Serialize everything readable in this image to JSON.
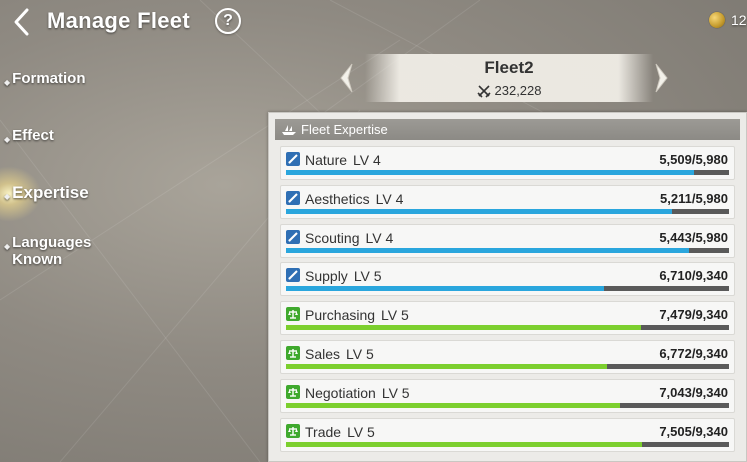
{
  "header": {
    "title": "Manage Fleet",
    "help_label": "?",
    "currency_value": "12"
  },
  "side_menu": {
    "items": [
      {
        "label": "Formation",
        "active": false
      },
      {
        "label": "Effect",
        "active": false
      },
      {
        "label": "Expertise",
        "active": true
      },
      {
        "label": "Languages Known",
        "active": false
      }
    ]
  },
  "fleet": {
    "name": "Fleet2",
    "power": "232,228"
  },
  "panel": {
    "title": "Fleet Expertise",
    "rows": [
      {
        "name": "Nature",
        "level": "LV 4",
        "value": "5,509/5,980",
        "progress": 0.921,
        "icon": "quill-icon",
        "color": "#2aa6dd"
      },
      {
        "name": "Aesthetics",
        "level": "LV 4",
        "value": "5,211/5,980",
        "progress": 0.871,
        "icon": "quill-icon",
        "color": "#2aa6dd"
      },
      {
        "name": "Scouting",
        "level": "LV 4",
        "value": "5,443/5,980",
        "progress": 0.91,
        "icon": "quill-icon",
        "color": "#2aa6dd"
      },
      {
        "name": "Supply",
        "level": "LV 5",
        "value": "6,710/9,340",
        "progress": 0.718,
        "icon": "quill-icon",
        "color": "#2aa6dd"
      },
      {
        "name": "Purchasing",
        "level": "LV 5",
        "value": "7,479/9,340",
        "progress": 0.801,
        "icon": "scales-icon",
        "color": "#7ccf2e"
      },
      {
        "name": "Sales",
        "level": "LV 5",
        "value": "6,772/9,340",
        "progress": 0.725,
        "icon": "scales-icon",
        "color": "#7ccf2e"
      },
      {
        "name": "Negotiation",
        "level": "LV 5",
        "value": "7,043/9,340",
        "progress": 0.754,
        "icon": "scales-icon",
        "color": "#7ccf2e"
      },
      {
        "name": "Trade",
        "level": "LV 5",
        "value": "7,505/9,340",
        "progress": 0.804,
        "icon": "scales-icon",
        "color": "#7ccf2e"
      }
    ]
  }
}
